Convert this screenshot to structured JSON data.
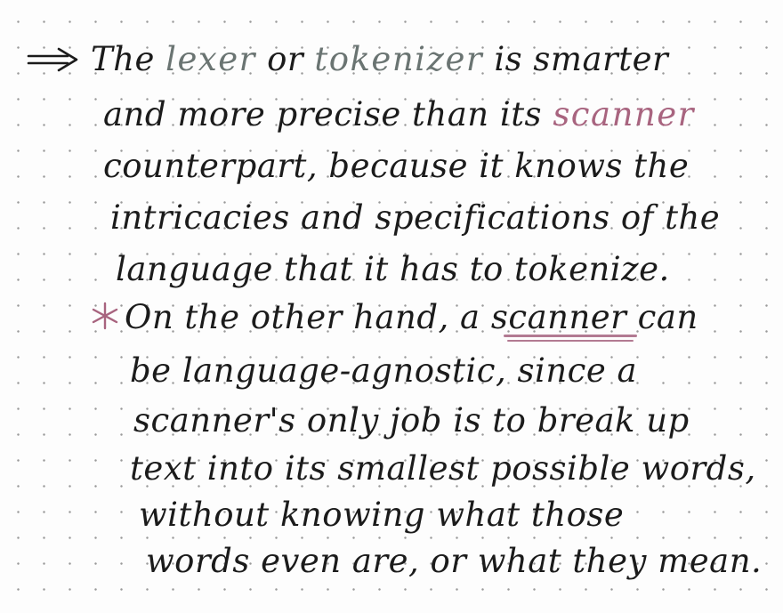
{
  "note": {
    "intro_lines": [
      {
        "segments": [
          {
            "text": "The "
          },
          {
            "text": "lexer",
            "style": "grey"
          },
          {
            "text": " or "
          },
          {
            "text": "tokenizer",
            "style": "grey"
          },
          {
            "text": " is smarter"
          }
        ]
      },
      {
        "segments": [
          {
            "text": "and more precise than its "
          },
          {
            "text": "scanner",
            "style": "pink"
          }
        ]
      },
      {
        "segments": [
          {
            "text": "counterpart, because it knows the"
          }
        ]
      },
      {
        "segments": [
          {
            "text": "intricacies and specifications of the"
          }
        ]
      },
      {
        "segments": [
          {
            "text": "language that it has to tokenize."
          }
        ]
      }
    ],
    "second_lines": [
      {
        "segments": [
          {
            "text": "On the other hand, a "
          },
          {
            "text": "scanner",
            "style": "underlined"
          },
          {
            "text": " can"
          }
        ]
      },
      {
        "segments": [
          {
            "text": "be language-agnostic, since a"
          }
        ]
      },
      {
        "segments": [
          {
            "text": "scanner's only job is to break up"
          }
        ]
      },
      {
        "segments": [
          {
            "text": "text into its smallest possible words,"
          }
        ]
      },
      {
        "segments": [
          {
            "text": "without knowing what those"
          }
        ]
      },
      {
        "segments": [
          {
            "text": "words even are, or what they mean."
          }
        ]
      }
    ],
    "markers": {
      "first": "double-arrow-icon",
      "second": "asterisk-icon"
    },
    "colors": {
      "ink": "#1b1b1b",
      "grey_highlight": "#6a7472",
      "pink_highlight": "#a8647f",
      "underline": "#b27a92",
      "dots": "#9a9a9a"
    }
  }
}
